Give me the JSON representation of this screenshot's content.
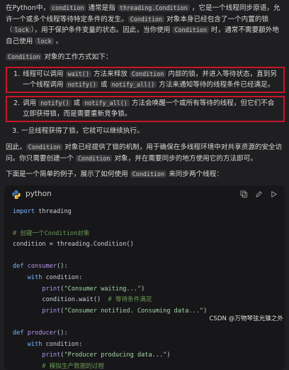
{
  "intro": {
    "t1": "在Python中，",
    "c1": "condition",
    "t2": " 通常是指 ",
    "c2": "threading.Condition",
    "t3": " ，它是一个线程同步原语，允许一个或多个线程等待特定条件的发生。",
    "c3": "Condition",
    "t4": " 对象本身已经包含了一个内置的锁（",
    "c4": "lock",
    "t5": "），用于保护条件变量的状态。因此，当你使用 ",
    "c5": "Condition",
    "t6": " 时，通常不需要额外地自己使用 ",
    "c6": "lock",
    "t7": " 。"
  },
  "how_it_works": {
    "c1": "Condition",
    "t1": " 对象的工作方式如下："
  },
  "list": [
    {
      "num": "1.",
      "t1": "线程可以调用 ",
      "c1": "wait()",
      "t2": " 方法来释放 ",
      "c2": "Condition",
      "t3": " 内部的锁，并进入等待状态，直到另一个线程调用 ",
      "c3": "notify()",
      "t4": " 或 ",
      "c4": "notify_all()",
      "t5": " 方法来通知等待的线程条件已经满足。"
    },
    {
      "num": "2.",
      "t1": "调用 ",
      "c1": "notify()",
      "t2": " 或 ",
      "c2": "notify_all()",
      "t3": " 方法会唤醒一个或所有等待的线程，但它们不会立即获得锁，而是需要重新竞争锁。"
    },
    {
      "num": "3.",
      "t1": "一旦线程获得了锁，它就可以继续执行。"
    }
  ],
  "summary": {
    "t1": "因此，",
    "c1": "Condition",
    "t2": " 对象已经提供了锁的机制，用于确保在多线程环境中对共享资源的安全访问。你只需要创建一个 ",
    "c2": "Condition",
    "t3": " 对象，并在需要同步的地方使用它的方法即可。"
  },
  "example": {
    "t1": "下面是一个简单的例子，展示了如何使用 ",
    "c1": "Condition",
    "t2": " 来同步两个线程："
  },
  "codeblock": {
    "language": "python",
    "icons": [
      "copy-icon",
      "edit-icon",
      "run-icon"
    ],
    "lines": {
      "l1_kw": "import",
      "l1_rest": " threading",
      "l3": "# 创建一个Condition对象",
      "l4": "condition = threading.Condition()",
      "l6_kw": "def",
      "l6_fn": " consumer",
      "l6_rest": "():",
      "l7_a": "    ",
      "l7_kw": "with",
      "l7_rest": " condition:",
      "l8_a": "        ",
      "l8_fn": "print",
      "l8_b": "(",
      "l8_str": "\"Consumer waiting...\"",
      "l8_c": ")",
      "l9_a": "        condition.wait()  ",
      "l9_cm": "# 等待条件满足",
      "l10_a": "        ",
      "l10_fn": "print",
      "l10_b": "(",
      "l10_str": "\"Consumer notified. Consuming data...\"",
      "l10_c": ")",
      "l12_kw": "def",
      "l12_fn": " producer",
      "l12_rest": "():",
      "l13_a": "    ",
      "l13_kw": "with",
      "l13_rest": " condition:",
      "l14_a": "        ",
      "l14_fn": "print",
      "l14_b": "(",
      "l14_str": "\"Producer producing data...\"",
      "l14_c": ")",
      "l15_a": "        ",
      "l15_cm": "# 模拟生产数据的过程"
    }
  },
  "watermark": "CSDN @万物琴弦光锥之外",
  "colors": {
    "background": "#1f1f21",
    "highlight_border": "#c8162a"
  }
}
